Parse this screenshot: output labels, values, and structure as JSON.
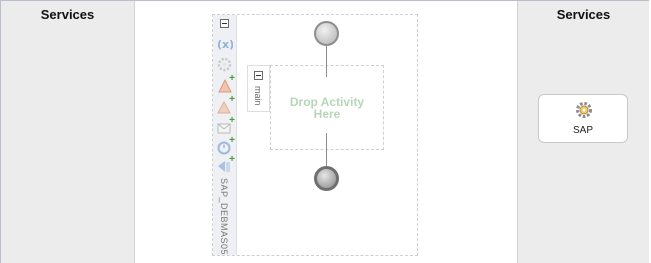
{
  "lanes": {
    "left_title": "Services",
    "right_title": "Services"
  },
  "scope": {
    "name": "SAP_DEBMAS05",
    "tools": [
      "variables-icon",
      "settings-gear-icon",
      "add-fault-handler-icon",
      "add-catch-icon",
      "add-message-icon",
      "add-event-icon",
      "add-partner-link-icon"
    ]
  },
  "sequence": {
    "label": "main",
    "drop_text": "Drop Activity Here"
  },
  "services_right": [
    {
      "label": "SAP",
      "icon": "gear-service-icon"
    }
  ],
  "colors": {
    "lane_bg": "#ececec",
    "drop_text": "#b7d6b7",
    "add_plus": "#4a9b3d"
  }
}
